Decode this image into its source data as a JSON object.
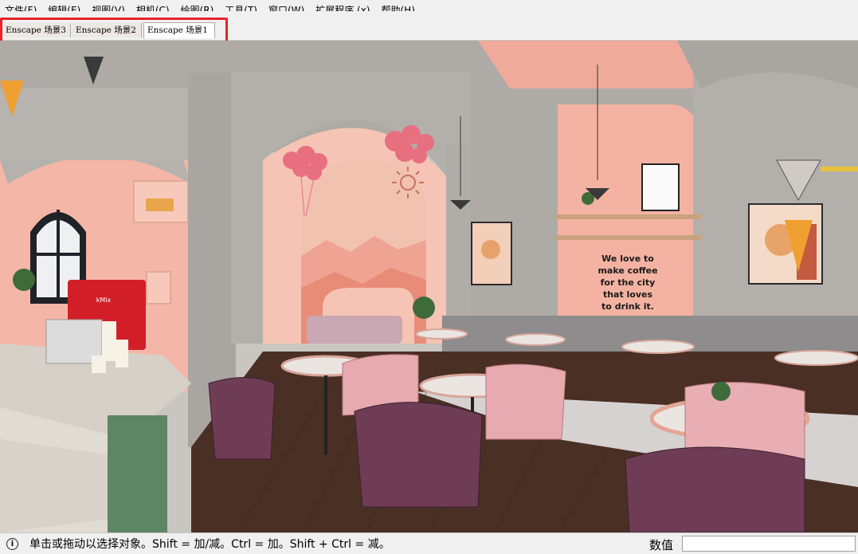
{
  "menu": {
    "items": [
      "文件(F)",
      "编辑(E)",
      "视图(V)",
      "相机(C)",
      "绘图(R)",
      "工具(T)",
      "窗口(W)",
      "扩展程序 (x)",
      "帮助(H)"
    ]
  },
  "scene_tabs": [
    {
      "label": "Enscape 场景3",
      "active": false
    },
    {
      "label": "Enscape 场景2",
      "active": false
    },
    {
      "label": "Enscape 场景1",
      "active": true
    }
  ],
  "viewport": {
    "wall_text": [
      "We love to",
      "make coffee",
      "for the city",
      "that loves",
      "to drink it."
    ],
    "machine_brand": "kMix"
  },
  "status": {
    "message": "单击或拖动以选择对象。Shift = 加/减。Ctrl = 加。Shift + Ctrl = 减。",
    "value_label": "数值",
    "value": ""
  },
  "colors": {
    "highlight": "#e8212b",
    "pink_wall": "#f3b3a3",
    "concrete": "#b9b6b2",
    "chair_purple": "#6e3d55"
  }
}
